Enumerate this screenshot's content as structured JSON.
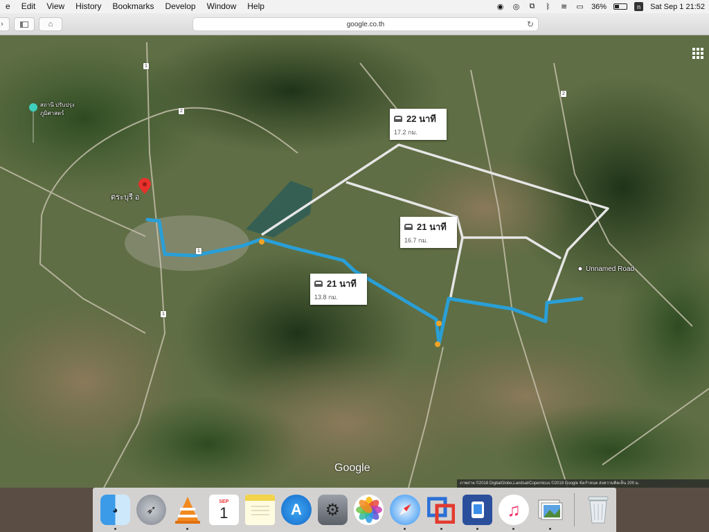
{
  "menubar": {
    "app_menus": [
      "e",
      "Edit",
      "View",
      "History",
      "Bookmarks",
      "Develop",
      "Window",
      "Help"
    ],
    "battery_percent": "36%",
    "user_initial": "n",
    "clock": "Sat Sep 1  21:52"
  },
  "browser": {
    "url": "google.co.th"
  },
  "map": {
    "routes": [
      {
        "time": "22 นาที",
        "distance": "17.2 กม.",
        "selected": false
      },
      {
        "time": "21 นาที",
        "distance": "16.7 กม.",
        "selected": false
      },
      {
        "time": "21 นาที",
        "distance": "13.8 กม.",
        "selected": true
      }
    ],
    "destination_label": "Unnamed Road",
    "origin_label": "ตระบุรี อ",
    "poi_label_line1": "สถานี ปรับปรุง",
    "poi_label_line2": "ภูมิศาสตร์",
    "road_shields": [
      "1",
      "1",
      "1",
      "2",
      "2"
    ],
    "google_logo": "Google",
    "attribution": "ภาพถ่าย ©2018 DigitalGlobe,Landsat/Copernicus ©2018 Google  ข้อกำหนด  ส่งความคิดเห็น  200 ม.",
    "colors": {
      "route_selected": "#2a9fd6",
      "route_alt": "#e6e6e6",
      "origin_pin": "#e8312c"
    }
  },
  "dock": {
    "apps": [
      {
        "name": "finder-icon",
        "running": true
      },
      {
        "name": "launchpad-icon",
        "running": false
      },
      {
        "name": "vlc-icon",
        "running": true
      },
      {
        "name": "calendar-icon",
        "running": false,
        "day": "1",
        "month": "SEP"
      },
      {
        "name": "notes-icon",
        "running": false
      },
      {
        "name": "app-store-icon",
        "running": false
      },
      {
        "name": "system-preferences-icon",
        "running": false
      },
      {
        "name": "photos-icon",
        "running": false
      },
      {
        "name": "safari-icon",
        "running": true
      },
      {
        "name": "parallels-icon",
        "running": true
      },
      {
        "name": "simulator-icon",
        "running": true
      },
      {
        "name": "itunes-icon",
        "running": true
      },
      {
        "name": "preview-icon",
        "running": true
      },
      {
        "name": "trash-icon",
        "running": false
      }
    ]
  }
}
